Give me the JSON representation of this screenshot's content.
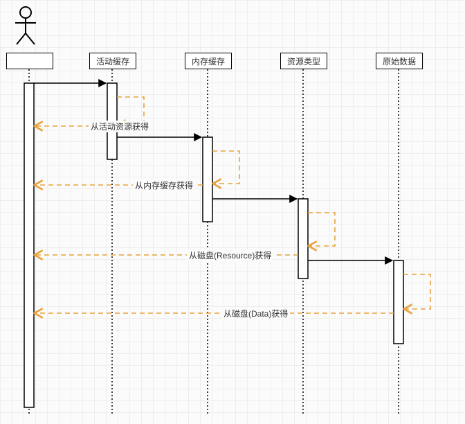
{
  "lanes": {
    "l0": "",
    "l1": "活动缓存",
    "l2": "内存缓存",
    "l3": "资源类型",
    "l4": "原始数据"
  },
  "messages": {
    "m1": "从活动资源获得",
    "m2": "从内存缓存获得",
    "m3": "从磁盘(Resource)获得",
    "m4": "从磁盘(Data)获得"
  }
}
